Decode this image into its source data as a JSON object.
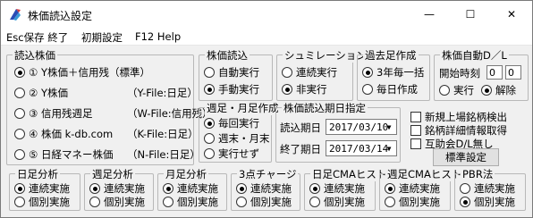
{
  "window": {
    "title": "株価読込設定",
    "minimize": "—",
    "maximize": "☐",
    "close": "✕"
  },
  "menu": [
    "Esc保存 終了",
    "初期設定",
    "F12 Help"
  ],
  "stock_read": {
    "legend": "読込株価",
    "options": [
      {
        "label": "① Y株価＋信用残（標準）",
        "suffix": "",
        "selected": true
      },
      {
        "label": "② Y株価",
        "suffix": "（Y-File:日足）",
        "selected": false
      },
      {
        "label": "③ 信用残週足",
        "suffix": "（W-File:信用残）",
        "selected": false
      },
      {
        "label": "④ 株価 k-db.com",
        "suffix": "（K-File:日足）",
        "selected": false
      },
      {
        "label": "⑤ 日経マネー株価",
        "suffix": "（N-File:日足）",
        "selected": false
      }
    ]
  },
  "price_read": {
    "legend": "株価読込",
    "options": [
      {
        "label": "自動実行",
        "selected": false
      },
      {
        "label": "手動実行",
        "selected": true
      }
    ]
  },
  "simulation": {
    "legend": "シュミレーション",
    "options": [
      {
        "label": "連続実行",
        "selected": false
      },
      {
        "label": "非実行",
        "selected": true
      }
    ]
  },
  "past_create": {
    "legend": "過去足作成",
    "options": [
      {
        "label": "3年毎一括",
        "selected": true
      },
      {
        "label": "毎日作成",
        "selected": false
      }
    ]
  },
  "auto_dl": {
    "legend": "株価自動D／L",
    "start_label": "開始時刻",
    "hour": "0",
    "minute": "0",
    "options": [
      {
        "label": "実行",
        "selected": false
      },
      {
        "label": "解除",
        "selected": true
      }
    ]
  },
  "weekly_monthly": {
    "legend": "週足・月足作成",
    "options": [
      {
        "label": "毎回実行",
        "selected": true
      },
      {
        "label": "週末・月末",
        "selected": false
      },
      {
        "label": "実行せず",
        "selected": false
      }
    ]
  },
  "read_period": {
    "legend": "株価読込期日指定",
    "start_label": "読込期日",
    "start_value": "2017/03/10",
    "end_label": "終了期日",
    "end_value": "2017/03/14"
  },
  "checks": [
    {
      "label": "新規上場銘柄検出",
      "checked": false
    },
    {
      "label": "銘柄詳細情報取得",
      "checked": false
    },
    {
      "label": "互助会D/L無し",
      "checked": false
    }
  ],
  "standard_button": "標準設定",
  "analysis": [
    {
      "legend": "日足分析",
      "options": [
        {
          "label": "連続実施",
          "selected": true
        },
        {
          "label": "個別実施",
          "selected": false
        }
      ]
    },
    {
      "legend": "週足分析",
      "options": [
        {
          "label": "連続実施",
          "selected": true
        },
        {
          "label": "個別実施",
          "selected": false
        }
      ]
    },
    {
      "legend": "月足分析",
      "options": [
        {
          "label": "連続実施",
          "selected": true
        },
        {
          "label": "個別実施",
          "selected": false
        }
      ]
    },
    {
      "legend": "3点チャージ",
      "options": [
        {
          "label": "連続実施",
          "selected": true
        },
        {
          "label": "個別実施",
          "selected": false
        }
      ]
    },
    {
      "legend": "日足CMAヒスト",
      "options": [
        {
          "label": "連続実施",
          "selected": true
        },
        {
          "label": "個別実施",
          "selected": false
        }
      ]
    },
    {
      "legend": "週足CMAヒスト",
      "options": [
        {
          "label": "連続実施",
          "selected": true
        },
        {
          "label": "個別実施",
          "selected": false
        }
      ]
    },
    {
      "legend": "PBR法",
      "options": [
        {
          "label": "連続実施",
          "selected": false
        },
        {
          "label": "個別実施",
          "selected": true
        }
      ]
    }
  ]
}
